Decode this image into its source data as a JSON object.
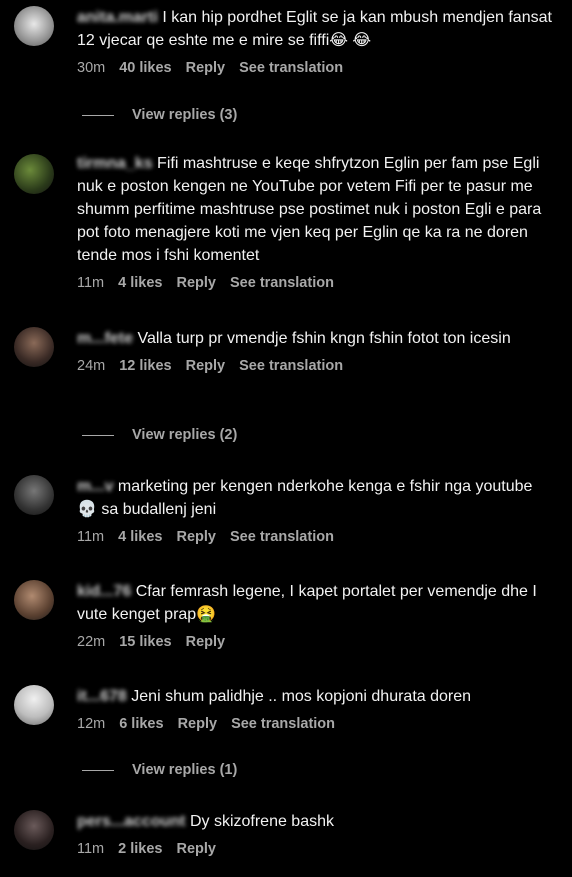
{
  "comments": [
    {
      "username": "anita.marti",
      "text": "I kan hip pordhet Eglit se ja kan mbush mendjen fansat 12 vjecar qe eshte me e mire se fiffi😂 😂",
      "time": "30m",
      "likes": "40 likes",
      "reply": "Reply",
      "translation": "See translation",
      "view_replies": "View replies (3)",
      "avatar_color": "#b8b8b8"
    },
    {
      "username": "tirmna_ks",
      "text": "Fifi mashtruse e keqe shfrytzon Eglin per fam pse Egli nuk e poston kengen ne YouTube por vetem Fifi per te pasur me shumm perfitime mashtruse pse postimet nuk i poston Egli e para pot foto menagjere koti me vjen keq per Eglin qe ka ra ne doren tende mos i fshi komentet",
      "time": "11m",
      "likes": "4 likes",
      "reply": "Reply",
      "translation": "See translation",
      "avatar_color": "#3d5a2a"
    },
    {
      "username": "m...fete",
      "text": "Valla turp pr vmendje fshin kngn fshin fotot ton icesin",
      "time": "24m",
      "likes": "12 likes",
      "reply": "Reply",
      "translation": "See translation",
      "view_replies": "View replies (2)",
      "avatar_color": "#5a4038"
    },
    {
      "username": "m...v",
      "text": "marketing per kengen nderkohe kenga e fshir nga youtube 💀 sa budallenj jeni",
      "time": "11m",
      "likes": "4 likes",
      "reply": "Reply",
      "translation": "See translation",
      "avatar_color": "#4a4a4a"
    },
    {
      "username": "kid...76",
      "text": "Cfar femrash legene, I kapet portalet per vemendje dhe I vute kenget prap🤮",
      "time": "22m",
      "likes": "15 likes",
      "reply": "Reply",
      "avatar_color": "#7a5a4a"
    },
    {
      "username": "it...678",
      "text": "Jeni shum palidhje .. mos kopjoni dhurata doren",
      "time": "12m",
      "likes": "6 likes",
      "reply": "Reply",
      "translation": "See translation",
      "view_replies": "View replies (1)",
      "avatar_color": "#cfcfcf"
    },
    {
      "username": "pers...account",
      "text": "Dy skizofrene bashk",
      "time": "11m",
      "likes": "2 likes",
      "reply": "Reply",
      "avatar_color": "#3a3030"
    }
  ]
}
